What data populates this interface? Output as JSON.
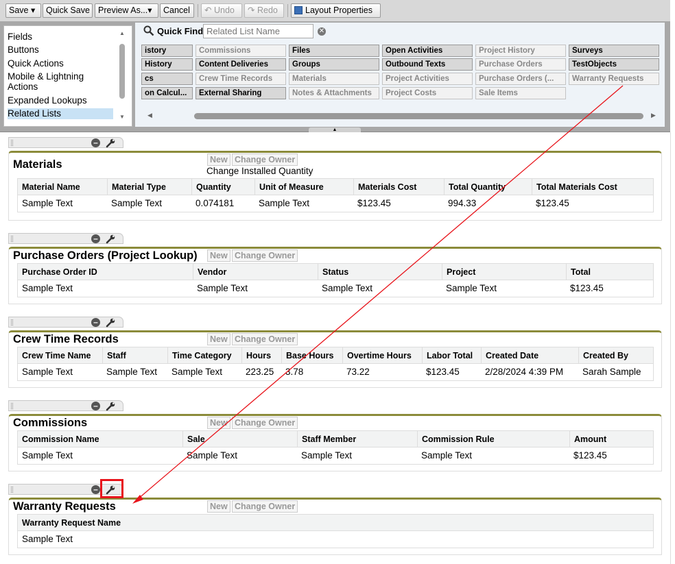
{
  "toolbar": {
    "save": "Save",
    "quick_save": "Quick Save",
    "preview_as": "Preview As...",
    "cancel": "Cancel",
    "undo": "Undo",
    "redo": "Redo",
    "layout_properties": "Layout Properties"
  },
  "categories": [
    "Fields",
    "Buttons",
    "Quick Actions",
    "Mobile & Lightning",
    "Actions",
    "Expanded Lookups",
    "Related Lists"
  ],
  "selected_category": "Related Lists",
  "quick_find": {
    "label": "Quick Find",
    "placeholder": "Related List Name"
  },
  "palette_items": [
    [
      "istory",
      "Commissions",
      "Files",
      "Open Activities",
      "Project History",
      "Surveys"
    ],
    [
      "History",
      "Content Deliveries",
      "Groups",
      "Outbound Texts",
      "Purchase Orders",
      "TestObjects"
    ],
    [
      "cs",
      "Crew Time Records",
      "Materials",
      "Project Activities",
      "Purchase Orders (...",
      "Warranty Requests"
    ],
    [
      "on Calcul...",
      "External Sharing",
      "Notes & Attachments",
      "Project Costs",
      "Sale Items"
    ]
  ],
  "section_buttons": {
    "new": "New",
    "change_owner": "Change Owner"
  },
  "sections": [
    {
      "title": "Materials",
      "extra_button": "Change Installed Quantity",
      "columns": [
        "Material Name",
        "Material Type",
        "Quantity",
        "Unit of Measure",
        "Materials Cost",
        "Total Quantity",
        "Total Materials Cost"
      ],
      "row": [
        "Sample Text",
        "Sample Text",
        "0.074181",
        "Sample Text",
        "$123.45",
        "994.33",
        "$123.45"
      ]
    },
    {
      "title": "Purchase Orders (Project Lookup)",
      "columns": [
        "Purchase Order ID",
        "Vendor",
        "Status",
        "Project",
        "Total"
      ],
      "row": [
        "Sample Text",
        "Sample Text",
        "Sample Text",
        "Sample Text",
        "$123.45"
      ]
    },
    {
      "title": "Crew Time Records",
      "columns": [
        "Crew Time Name",
        "Staff",
        "Time Category",
        "Hours",
        "Base Hours",
        "Overtime Hours",
        "Labor Total",
        "Created Date",
        "Created By"
      ],
      "row": [
        "Sample Text",
        "Sample Text",
        "Sample Text",
        "223.25",
        "3.78",
        "73.22",
        "$123.45",
        "2/28/2024 4:39 PM",
        "Sarah Sample"
      ]
    },
    {
      "title": "Commissions",
      "columns": [
        "Commission Name",
        "Sale",
        "Staff Member",
        "Commission Rule",
        "Amount"
      ],
      "row": [
        "Sample Text",
        "Sample Text",
        "Sample Text",
        "Sample Text",
        "$123.45"
      ]
    },
    {
      "title": "Warranty Requests",
      "columns": [
        "Warranty Request Name"
      ],
      "row": [
        "Sample Text"
      ]
    }
  ],
  "colors": {
    "accent_bar": "#8b8b3a",
    "highlight": "#e8141b",
    "selected": "#c8e2f5"
  }
}
